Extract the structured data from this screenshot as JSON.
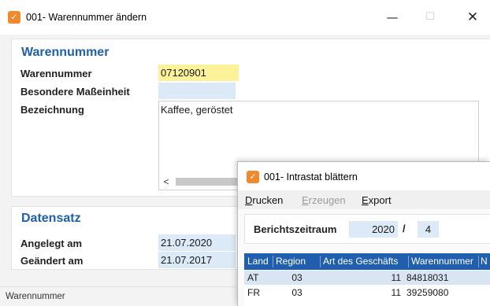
{
  "main_window": {
    "title": "001- Warennummer ändern",
    "controls": {
      "minimize": "—",
      "maximize": "☐",
      "close": "✕"
    },
    "section_warennummer": {
      "heading": "Warennummer",
      "warennummer_label": "Warennummer",
      "warennummer_value": "07120901",
      "masseinheit_label": "Besondere Maßeinheit",
      "masseinheit_value": "",
      "bezeichnung_label": "Bezeichnung",
      "bezeichnung_value": "Kaffee, geröstet",
      "scroll_left_arrow": "<"
    },
    "section_datensatz": {
      "heading": "Datensatz",
      "angelegt_label": "Angelegt am",
      "angelegt_value": "21.07.2020",
      "geaendert_label": "Geändert am",
      "geaendert_value": "21.07.2017"
    },
    "status_text": "Warennummer"
  },
  "child_window": {
    "title": "001- Intrastat blättern",
    "menu": [
      {
        "label": "Drucken",
        "mnemonic": "D",
        "rest": "rucken",
        "enabled": true
      },
      {
        "label": "Erzeugen",
        "mnemonic": "E",
        "rest": "rzeugen",
        "enabled": false
      },
      {
        "label": "Export",
        "mnemonic": "E",
        "rest": "xport",
        "enabled": true
      }
    ],
    "berichtszeitraum_label": "Berichtszeitraum",
    "berichtszeitraum_year": "2020",
    "berichtszeitraum_sep": "/",
    "berichtszeitraum_month": "4",
    "table": {
      "headers": [
        "Land",
        "Region",
        "Art des Geschäfts",
        "Warennummer",
        "N"
      ],
      "rows": [
        [
          "AT",
          "03",
          "11",
          "84818031",
          ""
        ],
        [
          "FR",
          "03",
          "11",
          "39259080",
          ""
        ]
      ]
    }
  },
  "colors": {
    "accent_blue": "#1f5fae",
    "field_blue": "#dce9f6",
    "field_yellow": "#fbf29a",
    "selected_row": "#d9e5f3",
    "app_icon_orange": "#f08a2c"
  },
  "icons": {
    "app_icon": "app-logo-icon"
  }
}
